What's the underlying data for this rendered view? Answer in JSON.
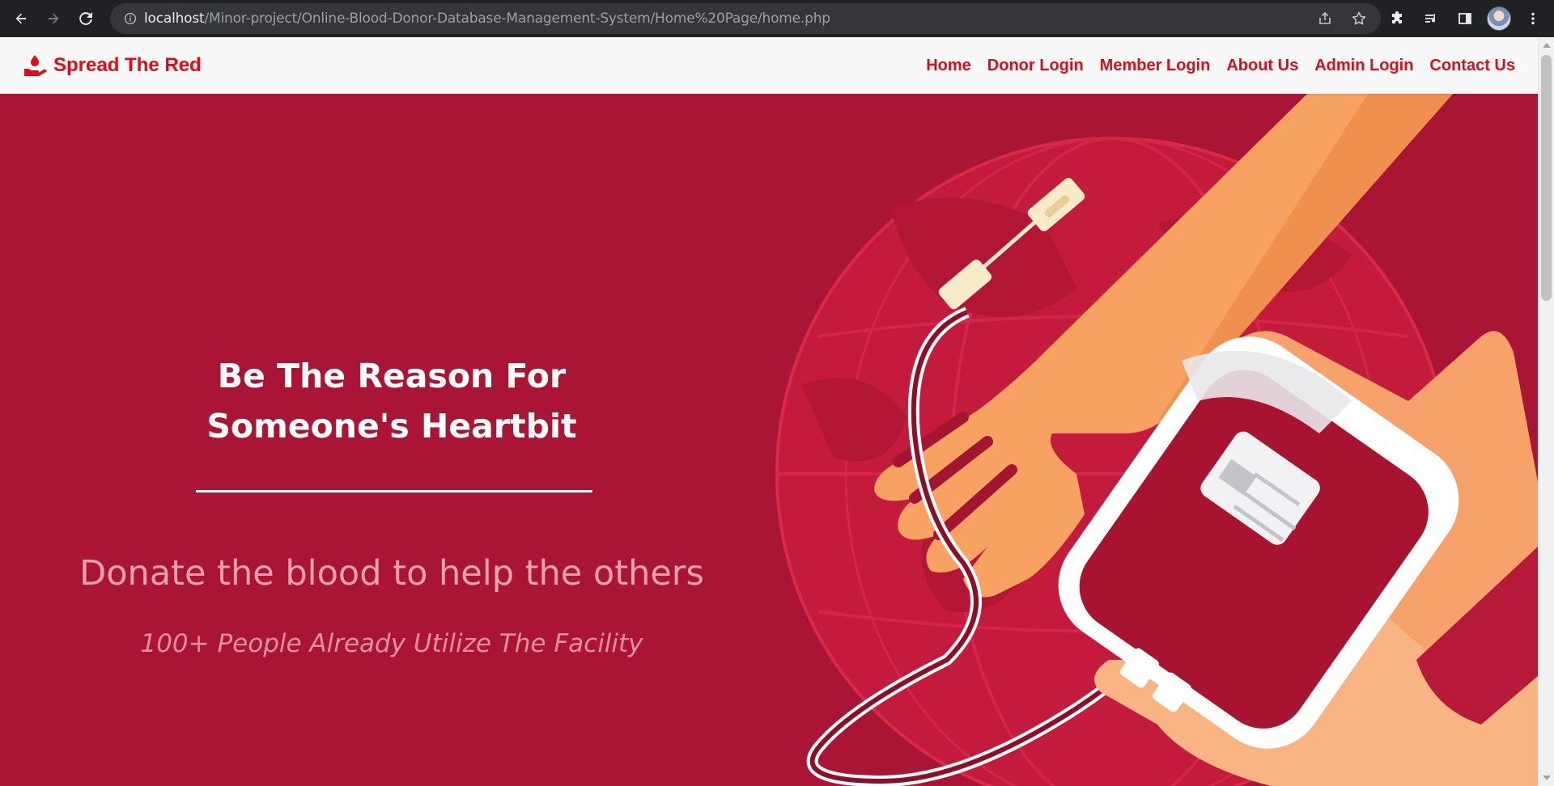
{
  "browser": {
    "url_host": "localhost",
    "url_path": "/Minor-project/Online-Blood-Donor-Database-Management-System/Home%20Page/home.php"
  },
  "brand": {
    "name": "Spread The Red",
    "icon": "hand-blood-drop-icon",
    "color": "#e30a17"
  },
  "nav": {
    "items": [
      {
        "label": "Home"
      },
      {
        "label": "Donor Login"
      },
      {
        "label": "Member Login"
      },
      {
        "label": "About Us"
      },
      {
        "label": "Admin Login"
      },
      {
        "label": "Contact Us"
      }
    ]
  },
  "hero": {
    "headline_line1": "Be The Reason For",
    "headline_line2": "Someone's Heartbit",
    "subline": "Donate the blood to help the others",
    "tagline": "100+ People Already Utilize The Facility",
    "background_color": "#ab1535"
  }
}
